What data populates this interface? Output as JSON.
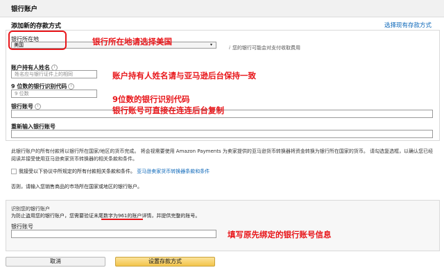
{
  "header": {
    "title": "银行账户"
  },
  "section": {
    "title": "添加新的存款方式",
    "choose_existing_link": "选择现有存款方式"
  },
  "form": {
    "country_label": "银行所在地",
    "country_value": "美国",
    "country_note": "您的银行可能会对支付收取费用",
    "holder_label": "账户持有人姓名",
    "holder_placeholder": "姓名应与银行证件上的相同",
    "routing_label": "9 位数的银行识别代码",
    "routing_placeholder": "9 位数",
    "account_label": "银行账号",
    "account_reenter_label": "重新输入银行账号"
  },
  "disclaimer": {
    "text": "此银行账户的所有付款将以银行所在国家/地区的货币完成。 将会视需要使用 Amazon Payments 为卖家提供的亚马逊货币转换器将资金转换为银行所在国家的货币。 请勾选复选框，以确认您已经阅读并接受使用亚马逊卖家货币转换器的相关条款和条件。",
    "checkbox_label": "我接受以下协议中所规定的所有付款相关条款和条件。",
    "checkbox_link": "亚马逊卖家货币转换器条款和条件",
    "else_note": "否则，请输入您销售商品的市场所在国家或地区的银行账户。"
  },
  "verify": {
    "title": "识别您的银行账户",
    "instruction": "为防止盗用您的银行账户，您需要验证末尾数字为961的账户详情，并提供完整的账号。",
    "account_label": "银行账号"
  },
  "annotations": {
    "a1": "银行所在地请选择美国",
    "a2": "账户持有人姓名请与亚马逊后台保持一致",
    "a3": "9位数的银行识别代码",
    "a4": "银行账号可直接在连连后台复制",
    "a5": "填写原先绑定的银行账号信息"
  },
  "buttons": {
    "cancel": "取消",
    "submit": "设置存款方式"
  },
  "icons": {
    "info": "info-icon",
    "dropdown": "chevron-down-icon"
  },
  "colors": {
    "annotation_red": "#e8161a",
    "link_blue": "#0a66b8",
    "primary_button": "#f3c44a"
  }
}
